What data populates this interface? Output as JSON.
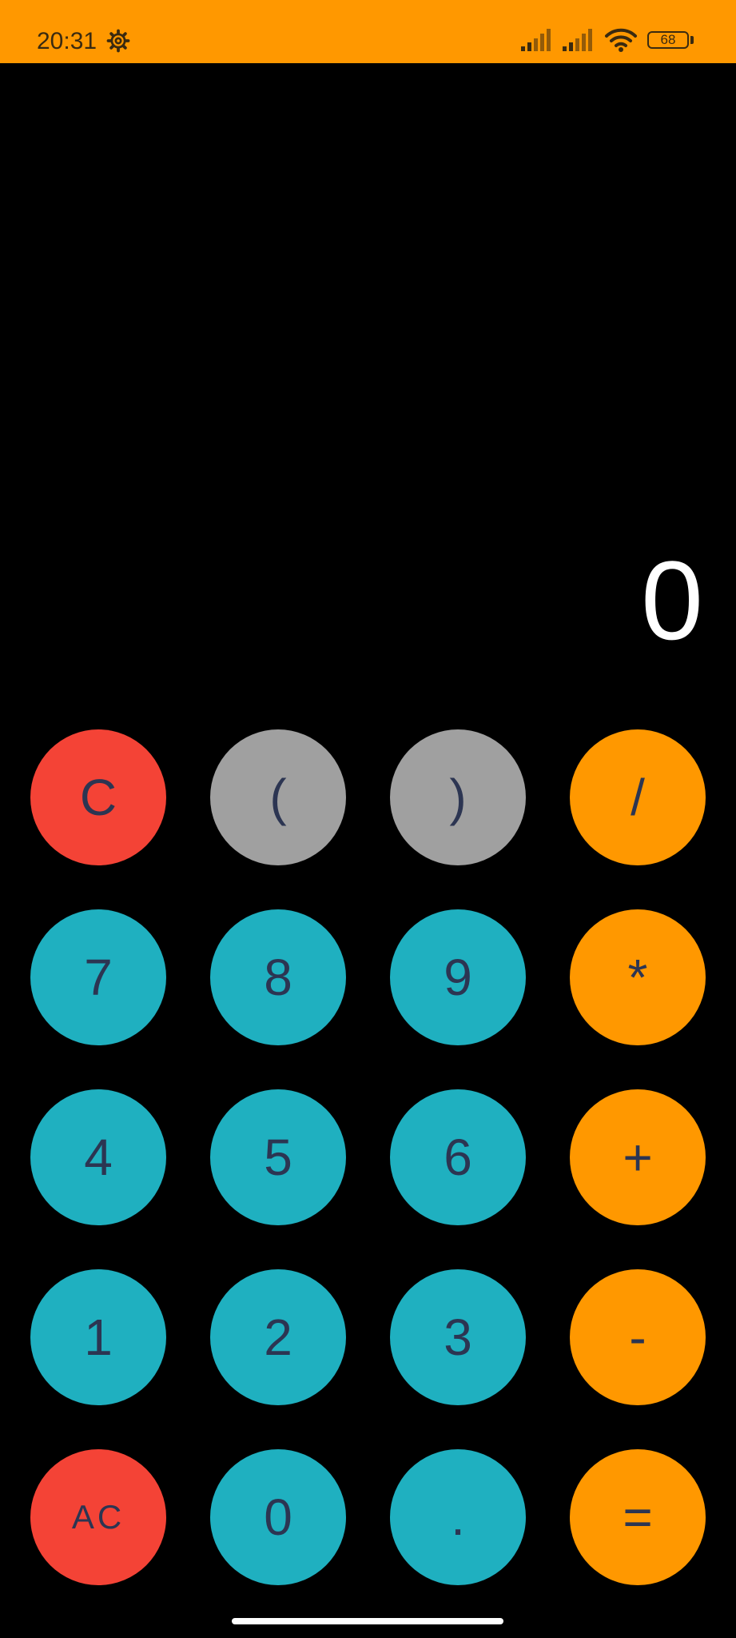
{
  "status_bar": {
    "time": "20:31",
    "battery_level": "68",
    "background": "#FF9800",
    "icons": [
      "gear-icon",
      "signal-icon",
      "signal-icon",
      "wifi-icon",
      "battery-icon"
    ]
  },
  "display": {
    "value": "0"
  },
  "keypad": {
    "rows": [
      [
        {
          "label": "C",
          "color": "#F44336"
        },
        {
          "label": "(",
          "color": "#A0A0A0"
        },
        {
          "label": ")",
          "color": "#A0A0A0"
        },
        {
          "label": "/",
          "color": "#FF9800"
        }
      ],
      [
        {
          "label": "7",
          "color": "#1FB0C0"
        },
        {
          "label": "8",
          "color": "#1FB0C0"
        },
        {
          "label": "9",
          "color": "#1FB0C0"
        },
        {
          "label": "*",
          "color": "#FF9800"
        }
      ],
      [
        {
          "label": "4",
          "color": "#1FB0C0"
        },
        {
          "label": "5",
          "color": "#1FB0C0"
        },
        {
          "label": "6",
          "color": "#1FB0C0"
        },
        {
          "label": "+",
          "color": "#FF9800"
        }
      ],
      [
        {
          "label": "1",
          "color": "#1FB0C0"
        },
        {
          "label": "2",
          "color": "#1FB0C0"
        },
        {
          "label": "3",
          "color": "#1FB0C0"
        },
        {
          "label": "-",
          "color": "#FF9800"
        }
      ],
      [
        {
          "label": "AC",
          "color": "#F44336"
        },
        {
          "label": "0",
          "color": "#1FB0C0"
        },
        {
          "label": ".",
          "color": "#1FB0C0"
        },
        {
          "label": "=",
          "color": "#FF9800"
        }
      ]
    ]
  }
}
